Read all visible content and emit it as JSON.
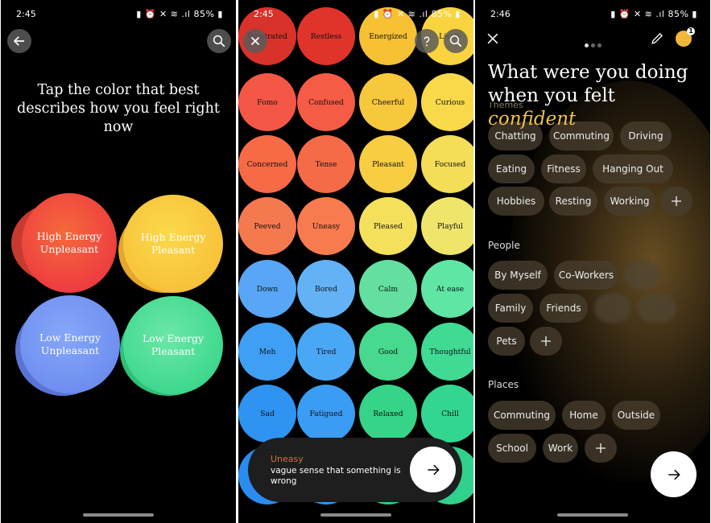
{
  "panel1": {
    "time": "2:45",
    "battery": "85%",
    "prompt": "Tap the color that best describes how you feel right now",
    "quadrants": [
      {
        "line1": "High Energy",
        "line2": "Unpleasant"
      },
      {
        "line1": "High Energy",
        "line2": "Pleasant"
      },
      {
        "line1": "Low Energy",
        "line2": "Unpleasant"
      },
      {
        "line1": "Low Energy",
        "line2": "Pleasant"
      }
    ]
  },
  "panel2": {
    "time": "2:45",
    "battery": "85%",
    "rows": [
      [
        "Frustrated",
        "Restless",
        "Energized",
        "Lively"
      ],
      [
        "Fomo",
        "Confused",
        "Cheerful",
        "Curious"
      ],
      [
        "Concerned",
        "Tense",
        "Pleasant",
        "Focused"
      ],
      [
        "Peeved",
        "Uneasy",
        "Pleased",
        "Playful"
      ],
      [
        "Down",
        "Bored",
        "Calm",
        "At ease"
      ],
      [
        "Meh",
        "Tired",
        "Good",
        "Thoughtful"
      ],
      [
        "Sad",
        "Fatigued",
        "Relaxed",
        "Chill"
      ]
    ],
    "selected_word": "Uneasy",
    "selected_desc": "vague sense that something is wrong"
  },
  "panel3": {
    "time": "2:46",
    "battery": "85%",
    "title_line1": "What were you doing",
    "title_line2_prefix": "when you felt",
    "feeling": "confident",
    "sections": {
      "themes": "Themes",
      "people": "People",
      "places": "Places"
    },
    "themes": [
      "Chatting",
      "Commuting",
      "Driving",
      "Eating",
      "Fitness",
      "Hanging Out",
      "Hobbies",
      "Resting",
      "Working"
    ],
    "people": [
      "By Myself",
      "Co-Workers",
      "Family",
      "Friends",
      "Pets"
    ],
    "places": [
      "Commuting",
      "Home",
      "Outside",
      "School",
      "Work"
    ],
    "notification_count": "1"
  },
  "colors": {
    "unpleasant_high": "#f04a3a",
    "pleasant_high": "#f7c33a",
    "unpleasant_low": "#6e8ff0",
    "pleasant_low": "#3fd98e",
    "accent_gold": "#f1c24e",
    "accent_red": "#ff5a49"
  }
}
